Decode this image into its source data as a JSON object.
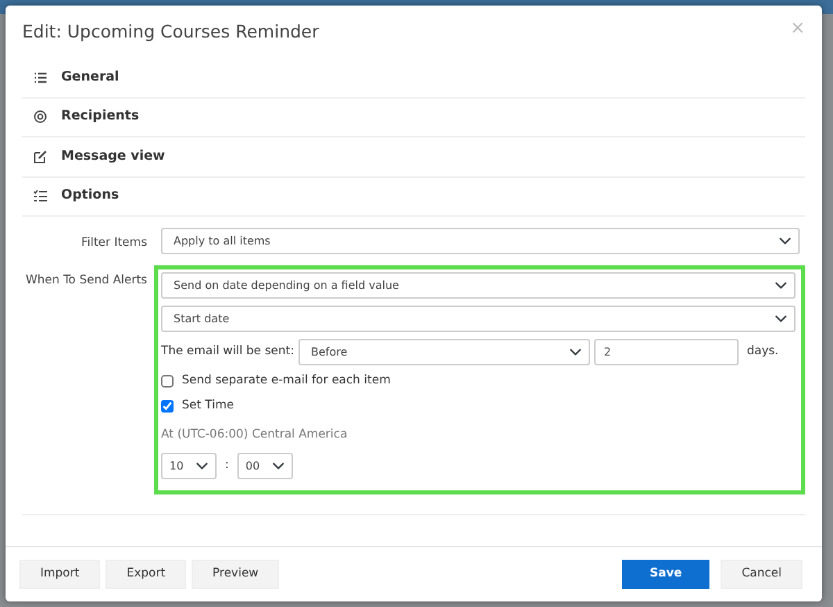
{
  "window": {
    "title": "Edit: Upcoming Courses Reminder",
    "close": "×"
  },
  "sections": [
    {
      "label": "General",
      "kind": "list"
    },
    {
      "label": "Recipients",
      "kind": "at"
    },
    {
      "label": "Message view",
      "kind": "edit"
    },
    {
      "label": "Options",
      "kind": "checklist"
    }
  ],
  "filter_items": {
    "label": "Filter Items",
    "value": "Apply to all items"
  },
  "when_to_send": {
    "label": "When To Send Alerts",
    "highlighted": true,
    "trigger": "Send on date depending on a field value",
    "field": "Start date",
    "sent_label": "The email will be sent:",
    "offset_direction": "Before",
    "offset_value": "2",
    "unit": "days.",
    "separate_email": {
      "label": "Send separate e-mail for each item",
      "checked": false
    },
    "set_time": {
      "label": "Set Time",
      "checked": true
    },
    "timezone": "At (UTC-06:00) Central America",
    "hour": "10",
    "separator": ":",
    "minute": "00"
  },
  "footer": {
    "left_buttons": [
      "Import",
      "Export",
      "Preview"
    ],
    "save": "Save",
    "cancel": "Cancel"
  }
}
